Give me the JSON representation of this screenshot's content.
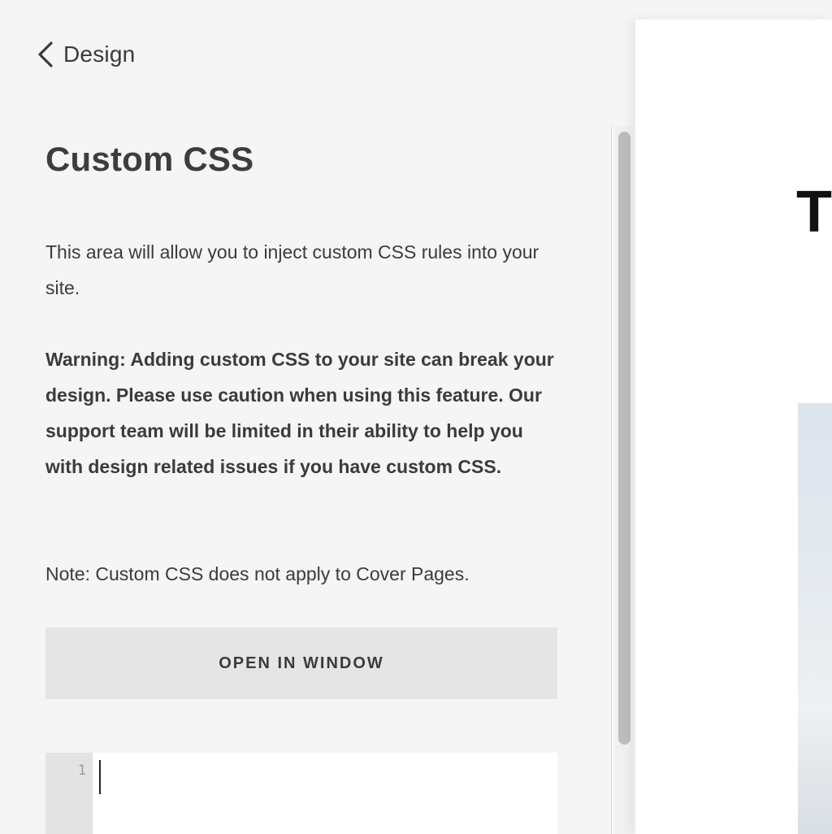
{
  "nav": {
    "back_label": "Design",
    "back_icon": "chevron-left-icon"
  },
  "page": {
    "title": "Custom CSS",
    "intro": "This area will allow you to inject custom CSS rules into your site.",
    "warning": "Warning: Adding custom CSS to your site can break your design. Please use caution when using this feature. Our support team will be limited in their ability to help you with design related issues if you have custom CSS.",
    "note": "Note: Custom CSS does not apply to Cover Pages.",
    "open_button_label": "OPEN IN WINDOW"
  },
  "editor": {
    "line_numbers": [
      "1"
    ],
    "content": ""
  },
  "preview": {
    "heading_fragment": "T"
  },
  "colors": {
    "panel_bg": "#f5f5f5",
    "button_bg": "#e5e5e5",
    "text": "#3b3b3b",
    "scroll_thumb": "#bdbdbd"
  }
}
